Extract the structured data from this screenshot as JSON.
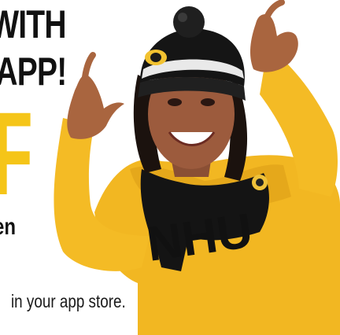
{
  "promo": {
    "headline_line_1": "WITH",
    "headline_line_2": "APP!",
    "big_letter": "F",
    "text_fragment": "en",
    "store_text": "in your app store.",
    "hat_logo": "penguin-logo",
    "sweatshirt_text": "NHU"
  },
  "colors": {
    "brand_gold": "#f5c518",
    "sweatshirt_yellow": "#f2b722",
    "text_dark": "#111111",
    "hat_black": "#151515"
  }
}
